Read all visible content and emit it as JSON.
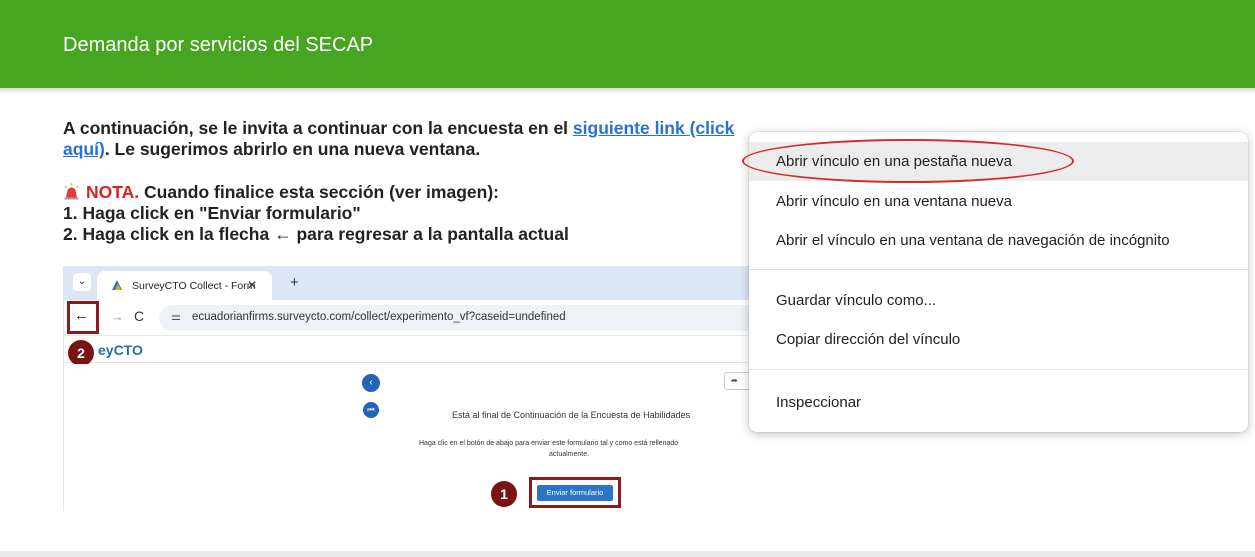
{
  "header": {
    "title": "Demanda por servicios del SECAP"
  },
  "intro": {
    "line1_text": "A continuación, se le invita a continuar con la encuesta en el ",
    "link_part1": "siguiente link (click",
    "link_part2": "aquí)",
    "line2_rest": ". Le sugerimos abrirlo en una nueva ventana."
  },
  "note": {
    "label": "NOTA.",
    "text": " Cuando finalice esta sección (ver imagen):",
    "step1": "1. Haga click en \"Enviar formulario\"",
    "step2": "2. Haga click en la flecha ← para regresar a la pantalla actual"
  },
  "screenshot": {
    "tab_title": "SurveyCTO Collect - Form",
    "url": "ecuadorianfirms.surveycto.com/collect/experimento_vf?caseid=undefined",
    "logo_text": "eyCTO",
    "badge_back": "2",
    "badge_submit": "1",
    "final_text": "Está al final de Continuación de la Encuesta de Habilidades",
    "desc_line1": "Haga clic en el botón de abajo para enviar este formulario tal y como está rellenado",
    "desc_line2": "actualmente.",
    "submit_label": "Enviar formulario"
  },
  "context_menu": {
    "items": [
      {
        "label": "Abrir vínculo en una pestaña nueva",
        "highlighted": true
      },
      {
        "label": "Abrir vínculo en una ventana nueva"
      },
      {
        "label": "Abrir el vínculo en una ventana de navegación de incógnito"
      },
      {
        "label": "Guardar vínculo como..."
      },
      {
        "label": "Copiar dirección del vínculo"
      },
      {
        "label": "Inspeccionar"
      }
    ]
  },
  "colors": {
    "header_bg": "#48a522",
    "link": "#2a6fd6",
    "note_red": "#e02020",
    "highlight_ellipse": "#d42a2a",
    "badge": "#7a1414"
  }
}
